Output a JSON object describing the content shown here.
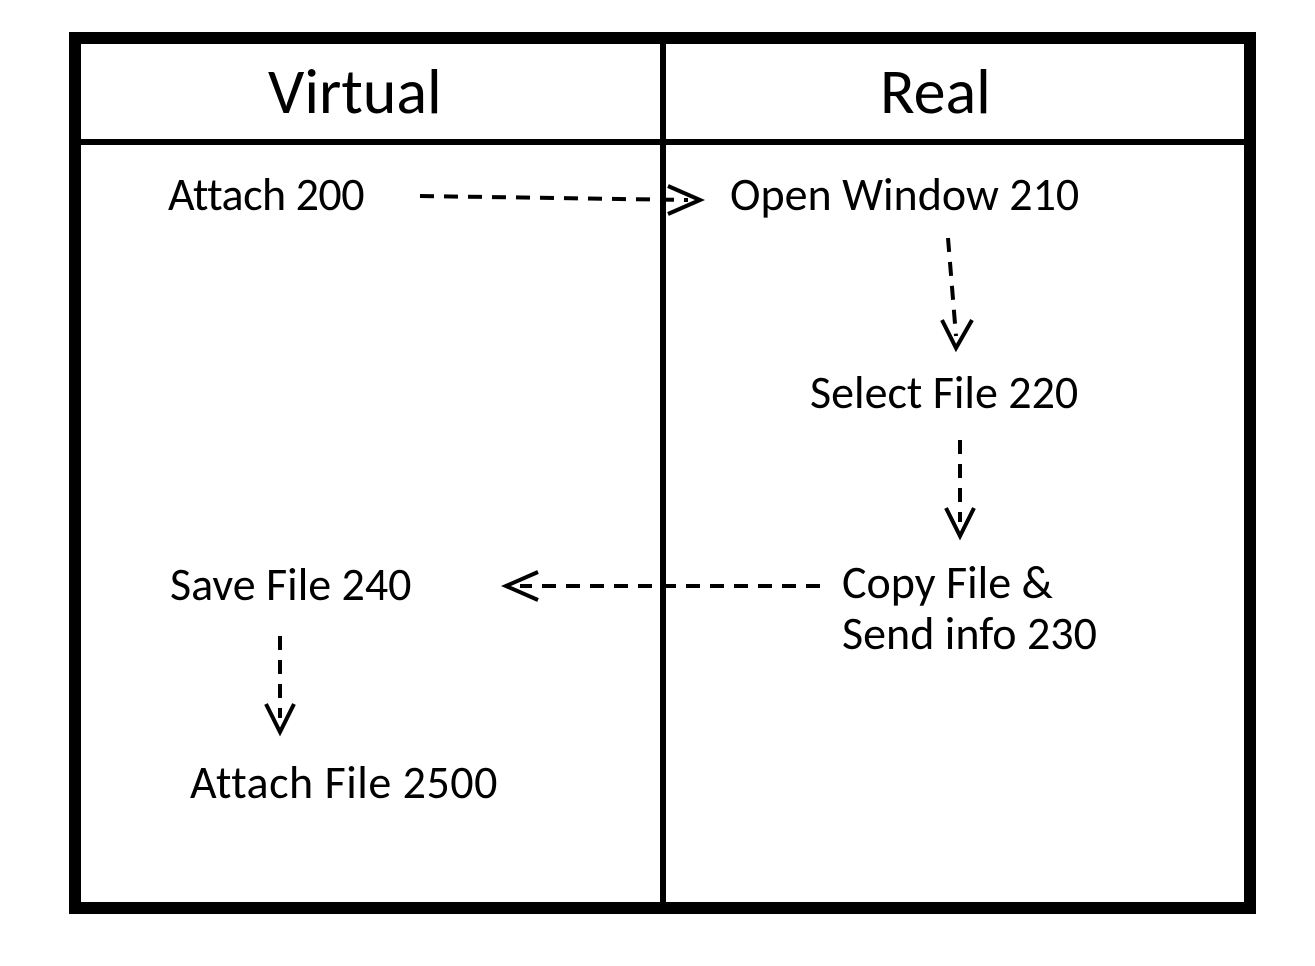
{
  "headers": {
    "virtual": "Virtual",
    "real": "Real"
  },
  "nodes": {
    "attach": "Attach   200",
    "open_window": "Open Window 210",
    "select_file": "Select File 220",
    "copy_send": "Copy File &\nSend info 230",
    "save_file": "Save File 240",
    "attach_file": "Attach  File 2500"
  }
}
